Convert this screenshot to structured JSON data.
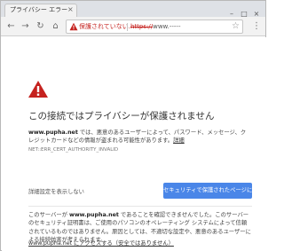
{
  "tab": {
    "title": "プライバシー エラー",
    "close_glyph": "×"
  },
  "window_controls": {
    "minimize": "–",
    "maximize": "□",
    "close": "×"
  },
  "toolbar": {
    "back_glyph": "←",
    "forward_glyph": "→",
    "reload_glyph": "↻",
    "home_glyph": "⌂",
    "menu_glyph": "⋮",
    "star_glyph": "☆"
  },
  "omnibox": {
    "status": "保護されていない...",
    "url_scheme": "https://",
    "url_host": "www.-----"
  },
  "error_page": {
    "heading": "この接続ではプライバシーが保護されません",
    "desc_host": "www.pupha.net",
    "desc_text": " では、悪意のあるユーザーによって、パスワード、メッセージ、クレジットカードなどの情報が盗まれる可能性があります。",
    "details_link": "詳細",
    "error_code": "NET::ERR_CERT_AUTHORITY_INVALID",
    "advanced_label": "詳細設定を表示しない",
    "back_to_safety_label": "セキュリティで保護されたページに戻る",
    "explanation_prefix": "このサーバーが ",
    "explanation_host": "www.pupha.net",
    "explanation_text": " であることを確認できませんでした。このサーバーのセキュリティ証明書は、ご使用のパソコンのオペレーティング システムによって信頼されているものではありません。原因としては、不適切な設定や、悪意のあるユーザーによる接続妨害が考えられます。",
    "proceed_link": "www.pupha.net にアクセスする（安全ではありません）"
  },
  "colors": {
    "accent_blue": "#4a86e8",
    "warning_red": "#c5221f"
  }
}
